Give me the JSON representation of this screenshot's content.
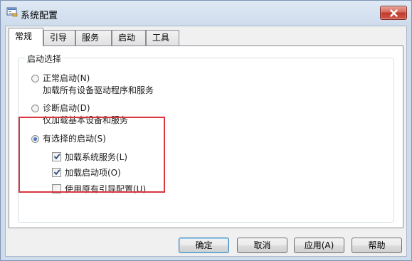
{
  "window": {
    "title": "系统配置",
    "icon": "system-config-icon"
  },
  "tabs": [
    {
      "label": "常规",
      "active": true
    },
    {
      "label": "引导",
      "active": false
    },
    {
      "label": "服务",
      "active": false
    },
    {
      "label": "启动",
      "active": false
    },
    {
      "label": "工具",
      "active": false
    }
  ],
  "startup_selection": {
    "group_label": "启动选择",
    "options": [
      {
        "label": "正常启动(N)",
        "description": "加载所有设备驱动程序和服务",
        "selected": false
      },
      {
        "label": "诊断启动(D)",
        "description": "仅加载基本设备和服务",
        "selected": false
      },
      {
        "label": "有选择的启动(S)",
        "selected": true
      }
    ],
    "selective_items": [
      {
        "label": "加载系统服务(L)",
        "checked": true
      },
      {
        "label": "加载启动项(O)",
        "checked": true
      },
      {
        "label": "使用原有引导配置(U)",
        "checked": false
      }
    ]
  },
  "buttons": {
    "ok": "确定",
    "cancel": "取消",
    "apply": "应用(A)",
    "help": "帮助"
  },
  "colors": {
    "highlight_border": "#d9363e",
    "close_button": "#c0392b",
    "title_bar": "#cfdcec"
  }
}
